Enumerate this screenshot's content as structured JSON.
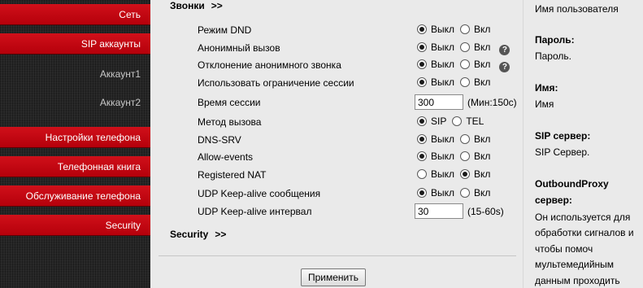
{
  "sidebar": {
    "items": [
      {
        "label": "Сеть",
        "kind": "red"
      },
      {
        "label": "SIP аккаунты",
        "kind": "red"
      },
      {
        "label": "Аккаунт1",
        "kind": "sub"
      },
      {
        "label": "Аккаунт2",
        "kind": "sub"
      },
      {
        "label": "Настройки телефона",
        "kind": "red"
      },
      {
        "label": "Телефонная книга",
        "kind": "red"
      },
      {
        "label": "Обслуживание телефона",
        "kind": "red"
      },
      {
        "label": "Security",
        "kind": "red"
      }
    ]
  },
  "main": {
    "calls_section": {
      "title": "Звонки",
      "arrows": ">>"
    },
    "rows": [
      {
        "label": "Режим DND",
        "type": "radio",
        "options": [
          "Выкл",
          "Вкл"
        ],
        "selected": "Выкл"
      },
      {
        "label": "Анонимный вызов",
        "type": "radio",
        "options": [
          "Выкл",
          "Вкл"
        ],
        "selected": "Выкл",
        "help": "?"
      },
      {
        "label": "Отклонение анонимного звонка",
        "type": "radio",
        "options": [
          "Выкл",
          "Вкл"
        ],
        "selected": "Выкл",
        "help": "?"
      },
      {
        "label": "Использовать ограничение сессии",
        "type": "radio",
        "options": [
          "Выкл",
          "Вкл"
        ],
        "selected": "Выкл"
      },
      {
        "label": "Время сессии",
        "type": "text",
        "value": "300",
        "hint": "(Мин:150с)"
      },
      {
        "label": "Метод вызова",
        "type": "radio",
        "options": [
          "SIP",
          "TEL"
        ],
        "selected": "SIP"
      },
      {
        "label": "DNS-SRV",
        "type": "radio",
        "options": [
          "Выкл",
          "Вкл"
        ],
        "selected": "Выкл"
      },
      {
        "label": "Allow-events",
        "type": "radio",
        "options": [
          "Выкл",
          "Вкл"
        ],
        "selected": "Выкл"
      },
      {
        "label": "Registered NAT",
        "type": "radio",
        "options": [
          "Выкл",
          "Вкл"
        ],
        "selected": "Вкл"
      },
      {
        "label": "UDP Keep-alive сообщения",
        "type": "radio",
        "options": [
          "Выкл",
          "Вкл"
        ],
        "selected": "Выкл"
      },
      {
        "label": "UDP Keep-alive интервал",
        "type": "text",
        "value": "30",
        "hint": "(15-60s)"
      }
    ],
    "security_section": {
      "title": "Security",
      "arrows": ">>"
    },
    "apply_label": "Применить"
  },
  "help_panel": {
    "lines": [
      {
        "text": "Имя пользователя",
        "bold": false
      },
      {
        "text": "Пароль:",
        "bold": true
      },
      {
        "text": "Пароль.",
        "bold": false
      },
      {
        "text": "Имя:",
        "bold": true
      },
      {
        "text": "Имя",
        "bold": false
      },
      {
        "text": "SIP сервер:",
        "bold": true
      },
      {
        "text": "SIP Сервер.",
        "bold": false
      },
      {
        "text": "OutboundProxy",
        "bold": true
      },
      {
        "text": "сервер:",
        "bold": true
      },
      {
        "text": "Он используется для",
        "bold": false
      },
      {
        "text": "обработки сигналов и",
        "bold": false
      },
      {
        "text": "чтобы помоч",
        "bold": false
      },
      {
        "text": "мультемедийным",
        "bold": false
      },
      {
        "text": "данным проходить",
        "bold": false
      }
    ]
  }
}
